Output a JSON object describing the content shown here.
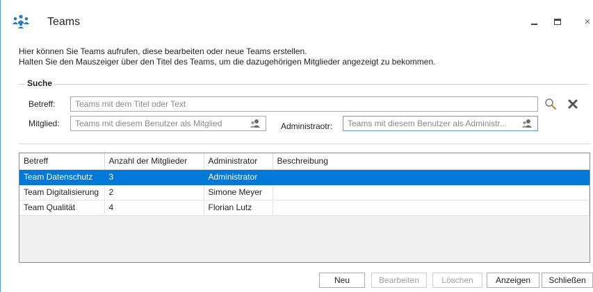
{
  "window": {
    "title": "Teams",
    "icon": "people-group-icon",
    "controls": {
      "minimize": "minimize-icon",
      "maximize": "maximize-icon",
      "close": "×"
    }
  },
  "intro": {
    "line1": "Hier können Sie Teams aufrufen, diese bearbeiten oder neue Teams erstellen.",
    "line2": "Halten Sie den Mauszeiger über den Titel des Teams, um die dazugehörigen Mitglieder angezeigt zu bekommen."
  },
  "search": {
    "legend": "Suche",
    "subject_label": "Betreff:",
    "subject_placeholder": "Teams mit dem Titel oder Text",
    "member_label": "Mitglied:",
    "member_placeholder": "Teams mit diesem Benutzer als Mitglied",
    "admin_label": "Administraotr:",
    "admin_placeholder": "Teams mit diesem Benutzer als Administr..."
  },
  "table": {
    "columns": [
      "Betreff",
      "Anzahl der Mitglieder",
      "Administrator",
      "Beschreibung"
    ],
    "rows": [
      [
        "Team Datenschutz",
        "3",
        "Administrator",
        ""
      ],
      [
        "Team Digitalisierung",
        "2",
        "Simone Meyer",
        ""
      ],
      [
        "Team Qualität",
        "4",
        "Florian Lutz",
        ""
      ]
    ],
    "selected_row": 0
  },
  "buttons": {
    "new": "Neu",
    "edit": "Bearbeiten",
    "delete": "Löschen",
    "show": "Anzeigen",
    "close": "Schließen"
  },
  "colors": {
    "selection": "#0078d7",
    "window_border": "#5b9bd5"
  }
}
